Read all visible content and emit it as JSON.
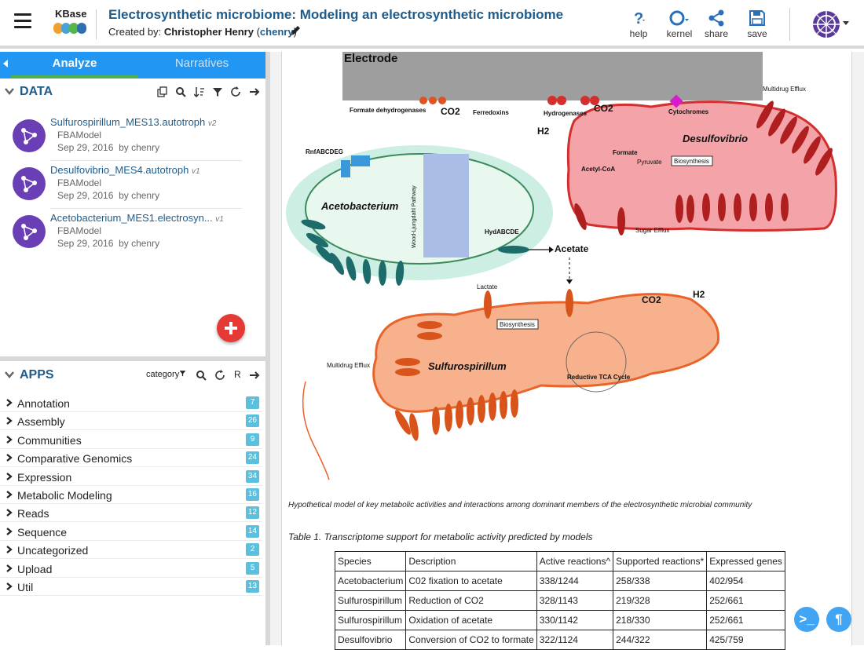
{
  "header": {
    "logo_text": "KBase",
    "title": "Electrosynthetic microbiome: Modeling an electrosynthetic microbiome",
    "created_by_prefix": "Created by:",
    "author": "Christopher Henry",
    "username": "chenry",
    "buttons": [
      {
        "label": "help",
        "icon": "question-icon"
      },
      {
        "label": "kernel",
        "icon": "circle-icon"
      },
      {
        "label": "share",
        "icon": "share-icon"
      },
      {
        "label": "save",
        "icon": "floppy-icon"
      }
    ]
  },
  "tabs": {
    "analyze": "Analyze",
    "narratives": "Narratives"
  },
  "data": {
    "title": "DATA",
    "items": [
      {
        "name": "Sulfurospirillum_MES13.autotroph",
        "version": "v2",
        "type": "FBAModel",
        "date": "Sep 29, 2016",
        "by": "by chenry"
      },
      {
        "name": "Desulfovibrio_MES4.autotroph",
        "version": "v1",
        "type": "FBAModel",
        "date": "Sep 29, 2016",
        "by": "by chenry"
      },
      {
        "name": "Acetobacterium_MES1.electrosyn...",
        "version": "v1",
        "type": "FBAModel",
        "date": "Sep 29, 2016",
        "by": "by chenry"
      }
    ]
  },
  "apps": {
    "title": "APPS",
    "category_label": "category",
    "r_label": "R",
    "categories": [
      {
        "label": "Annotation",
        "count": "7"
      },
      {
        "label": "Assembly",
        "count": "26"
      },
      {
        "label": "Communities",
        "count": "9"
      },
      {
        "label": "Comparative Genomics",
        "count": "24"
      },
      {
        "label": "Expression",
        "count": "34"
      },
      {
        "label": "Metabolic Modeling",
        "count": "16"
      },
      {
        "label": "Reads",
        "count": "12"
      },
      {
        "label": "Sequence",
        "count": "14"
      },
      {
        "label": "Uncategorized",
        "count": "2"
      },
      {
        "label": "Upload",
        "count": "5"
      },
      {
        "label": "Util",
        "count": "13"
      }
    ]
  },
  "figure": {
    "electrode": "Electrode",
    "acetobacterium": "Acetobacterium",
    "desulfovibrio": "Desulfovibrio",
    "sulfurospirillum": "Sulfurospirillum",
    "acetate": "Acetate",
    "co2": "CO2",
    "h2": "H2",
    "formate_dh": "Formate dehydrogenases",
    "ferredoxins": "Ferredoxins",
    "hydrogenases": "Hydrogenases",
    "cytochromes": "Cytochromes",
    "rnf": "RnfABCDEG",
    "hyd": "HydABCDE",
    "wlp": "Wood-Ljungdahl Pathway",
    "formate": "Formate",
    "acetyl_coa": "Acetyl-CoA",
    "pyruvate": "Pyruvate",
    "biosynthesis": "Biosynthesis",
    "tca": "Reductive TCA Cycle",
    "lactate": "Lactate",
    "multidrug_efflux": "Multidrug Efflux",
    "sugar_efflux": "Sugar Efflux"
  },
  "caption": "Hypothetical model of key metabolic activities and interactions among dominant members of the electrosynthetic microbial community",
  "table": {
    "caption": "Table 1. Transcriptome support for metabolic activity predicted by models",
    "headers": [
      "Species",
      "Description",
      "Active reactions^",
      "Supported reactions*",
      "Expressed genes"
    ],
    "rows": [
      [
        "Acetobacterium",
        "C02 fixation to acetate",
        "338/1244",
        "258/338",
        "402/954"
      ],
      [
        "Sulfurospirillum",
        "Reduction of CO2",
        "328/1143",
        "219/328",
        "252/661"
      ],
      [
        "Sulfurospirillum",
        "Oxidation of acetate",
        "330/1142",
        "218/330",
        "252/661"
      ],
      [
        "Desulfovibrio",
        "Conversion of CO2 to formate",
        "322/1124",
        "244/322",
        "425/759"
      ]
    ]
  },
  "colors": {
    "accent": "#2196f3",
    "title": "#1f5c8b",
    "badge": "#5bc0de",
    "add": "#e53935",
    "active_tab": "#4caf50"
  }
}
